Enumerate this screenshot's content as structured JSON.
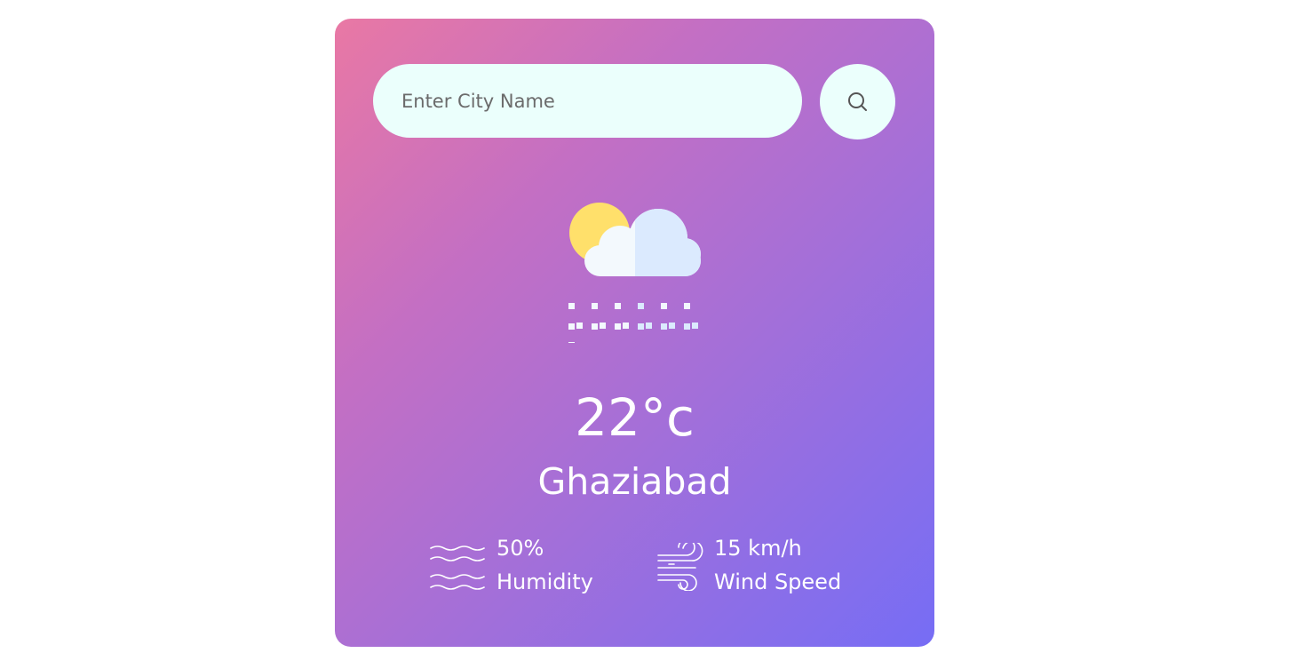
{
  "search": {
    "placeholder": "Enter City Name",
    "value": ""
  },
  "icons": {
    "search_button": "search-icon",
    "weather": "cloud-sun-snow-icon",
    "humidity": "humidity-waves-icon",
    "wind": "wind-icon"
  },
  "weather": {
    "temperature": "22°c",
    "city": "Ghaziabad"
  },
  "details": {
    "humidity_value": "50%",
    "humidity_label": "Humidity",
    "wind_value": "15 km/h",
    "wind_label": "Wind Speed"
  },
  "colors": {
    "gradient_start": "#e978a4",
    "gradient_end": "#766df5",
    "input_background": "#ebfffc",
    "sun": "#ffe06b",
    "text": "#ffffff"
  }
}
